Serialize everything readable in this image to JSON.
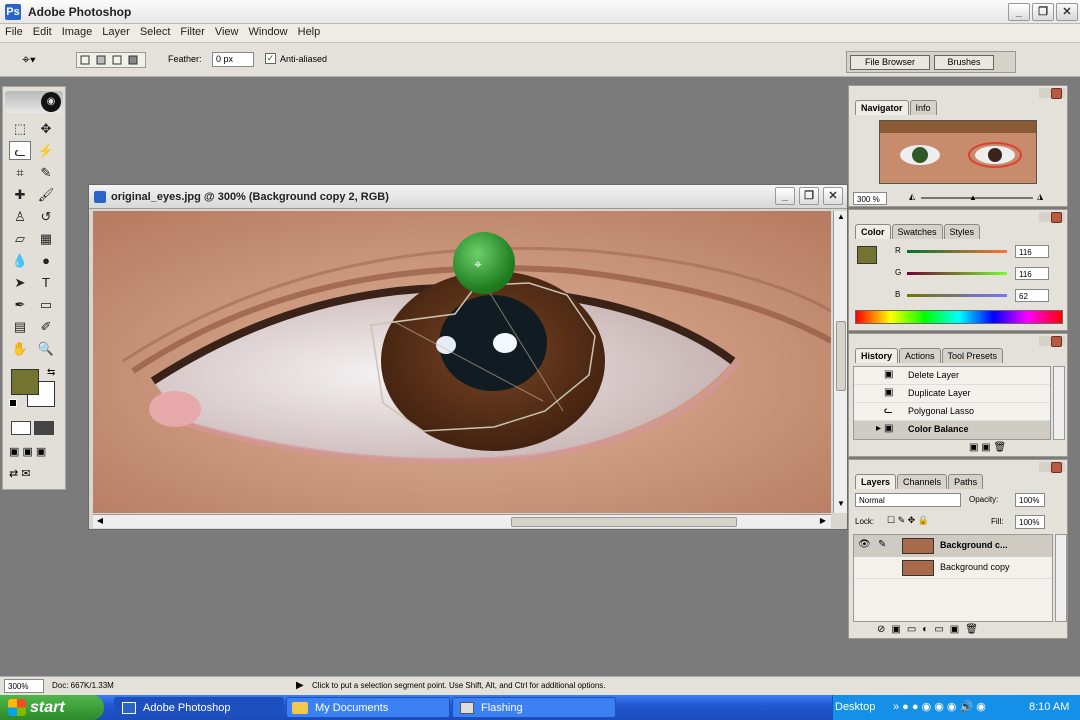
{
  "app": {
    "title": "Adobe Photoshop",
    "logo": "Ps"
  },
  "window_controls": {
    "minimize": "_",
    "restore": "❐",
    "close": "✕"
  },
  "menu": [
    "File",
    "Edit",
    "Image",
    "Layer",
    "Select",
    "Filter",
    "View",
    "Window",
    "Help"
  ],
  "options_bar": {
    "feather_label": "Feather:",
    "feather_value": "0 px",
    "antialiased_label": "Anti-aliased",
    "file_browser_label": "File Browser",
    "brushes_label": "Brushes"
  },
  "document": {
    "title": "original_eyes.jpg @ 300% (Background copy 2, RGB)",
    "colors": {
      "skin": "#c98f72",
      "iris": "#5a3018",
      "anchor": "#2a8a2a"
    }
  },
  "navigator": {
    "tabs": [
      "Navigator",
      "Info"
    ],
    "zoom": "300 %"
  },
  "color_palette": {
    "tabs": [
      "Color",
      "Swatches",
      "Styles"
    ],
    "channels": [
      {
        "label": "R",
        "value": "116"
      },
      {
        "label": "G",
        "value": "116"
      },
      {
        "label": "B",
        "value": "62"
      }
    ],
    "foreground": "#747431"
  },
  "history": {
    "tabs": [
      "History",
      "Actions",
      "Tool Presets"
    ],
    "items": [
      "Delete Layer",
      "Duplicate Layer",
      "Polygonal Lasso",
      "Color Balance"
    ]
  },
  "layers": {
    "tabs": [
      "Layers",
      "Channels",
      "Paths"
    ],
    "blend_mode": "Normal",
    "opacity_label": "Opacity:",
    "opacity_value": "100%",
    "lock_label": "Lock:",
    "fill_label": "Fill:",
    "fill_value": "100%",
    "items": [
      "Background c...",
      "Background copy"
    ]
  },
  "status": {
    "zoom": "300%",
    "doc": "Doc: 667K/1.33M",
    "message": "Click to put a selection segment point. Use Shift, Alt, and Ctrl for additional options."
  },
  "taskbar": {
    "start": "start",
    "buttons": [
      "Adobe Photoshop",
      "My Documents",
      "Flashing"
    ],
    "desktop": "Desktop",
    "clock": "8:10 AM"
  }
}
